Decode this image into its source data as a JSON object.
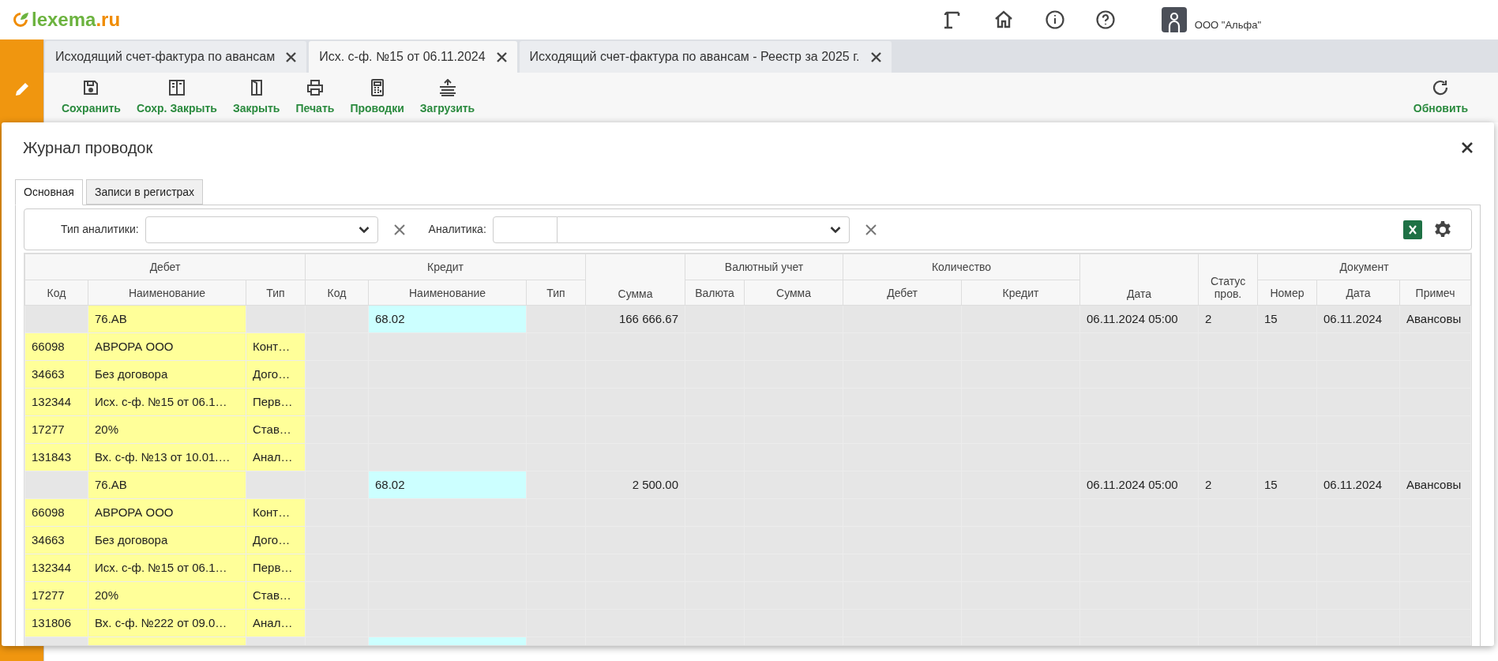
{
  "logo": {
    "text": "lexema",
    "suffix": ".ru"
  },
  "header": {
    "company": "ООО \"Альфа\""
  },
  "doc_tabs": [
    {
      "label": "Исходящий счет-фактура по авансам",
      "selected": false
    },
    {
      "label": "Исх. с-ф. №15 от 06.11.2024",
      "selected": true
    },
    {
      "label": "Исходящий счет-фактура по авансам - Реестр за 2025 г.",
      "selected": false
    }
  ],
  "toolbar": [
    {
      "kind": "save",
      "label": "Сохранить"
    },
    {
      "kind": "save_close",
      "label": "Сохр. Закрыть"
    },
    {
      "kind": "close",
      "label": "Закрыть"
    },
    {
      "kind": "print",
      "label": "Печать"
    },
    {
      "kind": "entries",
      "label": "Проводки"
    },
    {
      "kind": "upload",
      "label": "Загрузить"
    }
  ],
  "refresh": {
    "label": "Обновить"
  },
  "dialog": {
    "title": "Журнал проводок",
    "tabs": [
      {
        "label": "Основная",
        "selected": true
      },
      {
        "label": "Записи в регистрах",
        "selected": false
      }
    ],
    "filters": {
      "analytic_type_label": "Тип аналитики:",
      "analytic_label": "Аналитика:"
    },
    "column_groups": [
      {
        "label": "Дебет",
        "columns": [
          "Код",
          "Наименование",
          "Тип"
        ]
      },
      {
        "label": "Кредит",
        "columns": [
          "Код",
          "Наименование",
          "Тип"
        ]
      },
      {
        "label": "Сумма"
      },
      {
        "label": "Валютный учет",
        "columns": [
          "Валюта",
          "Сумма"
        ]
      },
      {
        "label": "Количество",
        "columns": [
          "Дебет",
          "Кредит"
        ]
      },
      {
        "label": "Дата"
      },
      {
        "label": "Статус пров."
      },
      {
        "label": "Документ",
        "columns": [
          "Номер",
          "Дата",
          "Примеч"
        ]
      }
    ],
    "rows": [
      {
        "kind": "entry",
        "debit_name": "76.АВ",
        "credit_name": "68.02",
        "amount": "166 666.67",
        "date": "06.11.2024 05:00",
        "status": "2",
        "doc_number": "15",
        "doc_date": "06.11.2024",
        "note": "Авансовы"
      },
      {
        "kind": "analytic",
        "debit_code": "66098",
        "debit_name": "АВРОРА ООО",
        "debit_type": "Конт…"
      },
      {
        "kind": "analytic",
        "debit_code": "34663",
        "debit_name": "Без договора",
        "debit_type": "Дого…"
      },
      {
        "kind": "analytic",
        "debit_code": "132344",
        "debit_name": "Исх. с-ф. №15 от 06.1…",
        "debit_type": "Перв…"
      },
      {
        "kind": "analytic",
        "debit_code": "17277",
        "debit_name": "20%",
        "debit_type": "Став…"
      },
      {
        "kind": "analytic",
        "debit_code": "131843",
        "debit_name": "Вх. с-ф. №13 от 10.01.…",
        "debit_type": "Анал…"
      },
      {
        "kind": "entry",
        "debit_name": "76.АВ",
        "credit_name": "68.02",
        "amount": "2 500.00",
        "date": "06.11.2024 05:00",
        "status": "2",
        "doc_number": "15",
        "doc_date": "06.11.2024",
        "note": "Авансовы"
      },
      {
        "kind": "analytic",
        "debit_code": "66098",
        "debit_name": "АВРОРА ООО",
        "debit_type": "Конт…"
      },
      {
        "kind": "analytic",
        "debit_code": "34663",
        "debit_name": "Без договора",
        "debit_type": "Дого…"
      },
      {
        "kind": "analytic",
        "debit_code": "132344",
        "debit_name": "Исх. с-ф. №15 от 06.1…",
        "debit_type": "Перв…"
      },
      {
        "kind": "analytic",
        "debit_code": "17277",
        "debit_name": "20%",
        "debit_type": "Став…"
      },
      {
        "kind": "analytic",
        "debit_code": "131806",
        "debit_name": "Вх. с-ф. №222 от 09.0…",
        "debit_type": "Анал…"
      },
      {
        "kind": "entry"
      }
    ]
  }
}
